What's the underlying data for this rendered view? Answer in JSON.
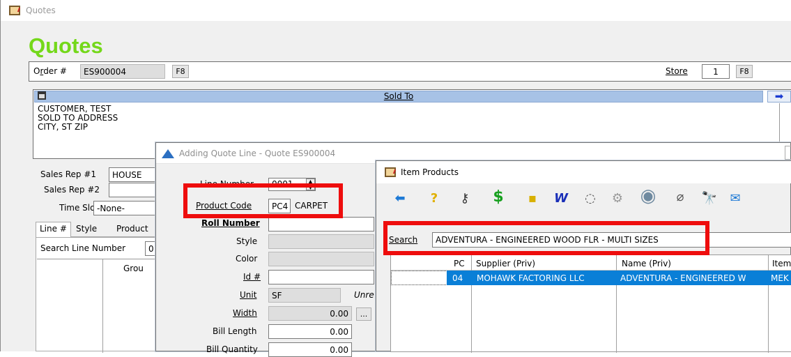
{
  "main_window": {
    "title": "Quotes",
    "heading": "Quotes",
    "order_label_u": "r",
    "order_label_pre": "O",
    "order_label_post": "der #",
    "order_value": "ES900004",
    "order_btn": "F8",
    "store_label": "Store",
    "store_value": "1",
    "store_btn": "F8",
    "sold_to_label": "Sold To",
    "sold_to_lines": [
      "CUSTOMER, TEST",
      "SOLD TO ADDRESS",
      "CITY, ST  ZIP"
    ],
    "sales_rep1_label": "Sales Rep #1",
    "sales_rep1_value": "HOUSE",
    "sales_rep2_label": "Sales Rep #2",
    "time_slot_label": "Time Slot",
    "time_slot_value": "-None-",
    "tabs": [
      "Line #",
      "Style",
      "Product"
    ],
    "search_line_label": "Search Line Number",
    "search_line_value": "0",
    "grid_col": "Grou"
  },
  "quote_line_dialog": {
    "title": "Adding Quote Line - Quote ES900004",
    "line_number_label": "Line Number",
    "line_number_value": "0001",
    "product_code_label": "Product Code",
    "product_code_value": "PC4",
    "product_code_desc": "CARPET",
    "roll_number_label": "Roll Number",
    "style_label": "Style",
    "color_label": "Color",
    "id_label": "Id #",
    "unit_label": "Unit",
    "unit_value": "SF",
    "unit_note": "Unre",
    "width_label": "Width",
    "width_value": "0.00",
    "width_btn": "...",
    "bill_length_label": "Bill Length",
    "bill_length_value": "0.00",
    "bill_quantity_label": "Bill Quantity",
    "bill_quantity_value": "0.00"
  },
  "item_products": {
    "title": "Item Products",
    "toolbar_icons": [
      "back-arrow-icon",
      "help-icon",
      "key-icon",
      "dollar-icon",
      "note-icon",
      "edit-document-icon",
      "eraser-icon",
      "gear-icon",
      "globe-icon",
      "paperclip-icon",
      "binoculars-icon",
      "mail-icon"
    ],
    "search_label": "Search",
    "search_value": "ADVENTURA - ENGINEERED WOOD FLR - MULTI SIZES",
    "columns": [
      "PC",
      "Supplier (Priv)",
      "Name (Priv)",
      "Item"
    ],
    "rows": [
      {
        "pc": "04",
        "supplier": "MOHAWK FACTORING LLC",
        "name": "ADVENTURA - ENGINEERED W",
        "item": "MEK"
      }
    ]
  },
  "colors": {
    "heading_green": "#74d81a",
    "highlight_red": "#ee0d0d",
    "selection_blue": "#0a7fd7",
    "sold_to_bar": "#a7c2e6"
  }
}
